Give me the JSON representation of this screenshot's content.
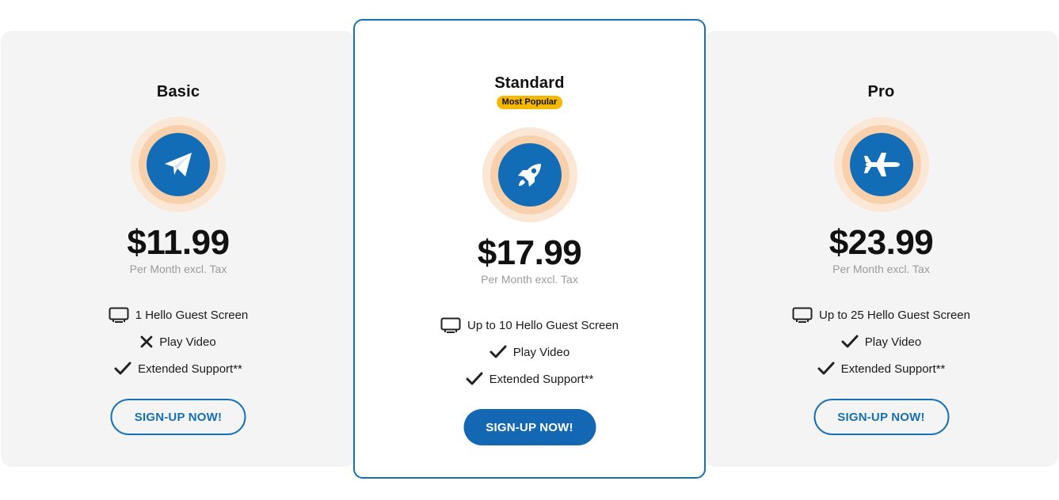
{
  "plans": [
    {
      "name": "Basic",
      "icon": "paper-plane-icon",
      "price": "$11.99",
      "price_note": "Per Month excl. Tax",
      "features": [
        {
          "icon": "monitor-icon",
          "text": "1 Hello Guest Screen"
        },
        {
          "icon": "x-icon",
          "text": "Play Video"
        },
        {
          "icon": "check-icon",
          "text": "Extended Support**"
        }
      ],
      "button": "SIGN-UP NOW!"
    },
    {
      "name": "Standard",
      "badge": "Most Popular",
      "icon": "rocket-icon",
      "price": "$17.99",
      "price_note": "Per Month excl. Tax",
      "features": [
        {
          "icon": "monitor-icon",
          "text": "Up to 10 Hello Guest Screen"
        },
        {
          "icon": "check-icon",
          "text": "Play Video"
        },
        {
          "icon": "check-icon",
          "text": "Extended Support**"
        }
      ],
      "button": "SIGN-UP NOW!"
    },
    {
      "name": "Pro",
      "icon": "airplane-icon",
      "price": "$23.99",
      "price_note": "Per Month excl. Tax",
      "features": [
        {
          "icon": "monitor-icon",
          "text": "Up to 25 Hello Guest Screen"
        },
        {
          "icon": "check-icon",
          "text": "Play Video"
        },
        {
          "icon": "check-icon",
          "text": "Extended Support**"
        }
      ],
      "button": "SIGN-UP NOW!"
    }
  ],
  "colors": {
    "accent": "#1670b8",
    "badge": "#f5b800",
    "icon_halo_outer": "#fbe7d6",
    "icon_halo_inner": "#f8d0ac",
    "card_background": "#f4f4f4"
  }
}
